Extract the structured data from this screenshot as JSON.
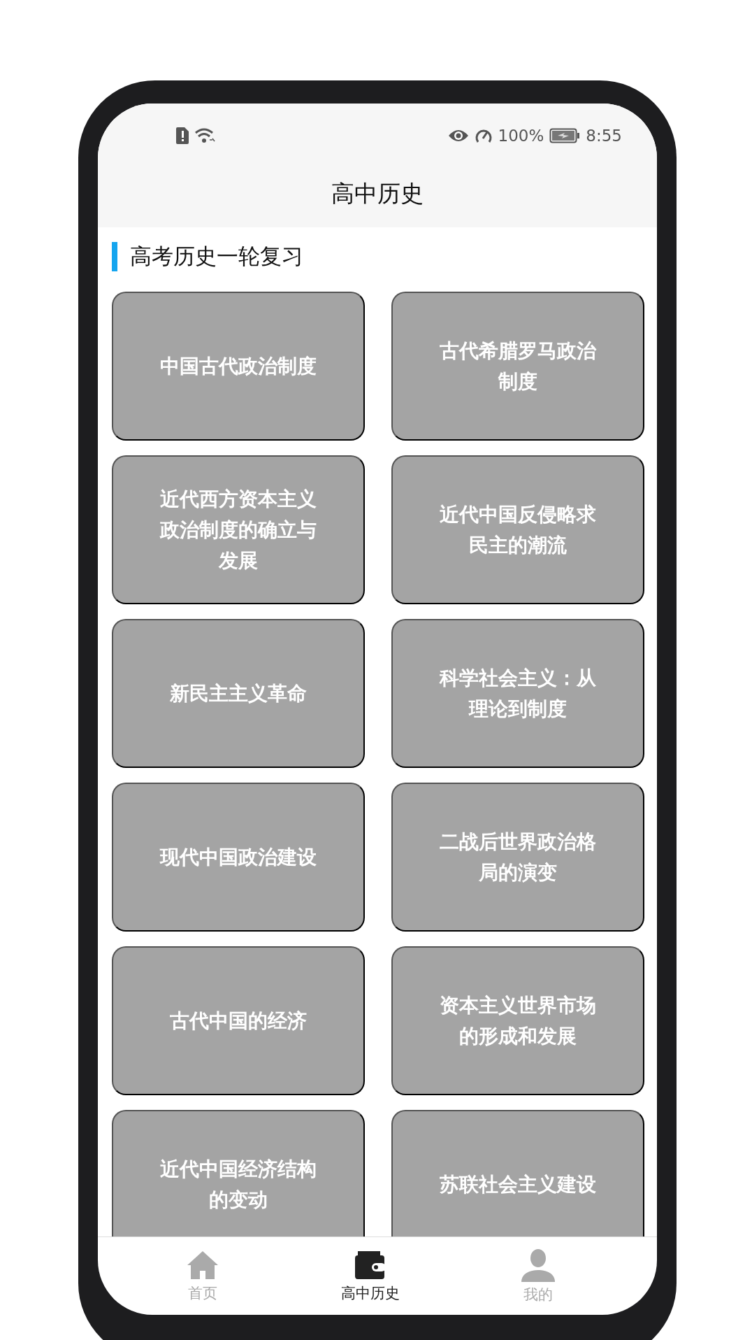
{
  "status_bar": {
    "battery": "100%",
    "time": "8:55"
  },
  "title": "高中历史",
  "section_title": "高考历史一轮复习",
  "topics": [
    "中国古代政治制度",
    "古代希腊罗马政治制度",
    "近代西方资本主义政治制度的确立与发展",
    "近代中国反侵略求民主的潮流",
    "新民主主义革命",
    "科学社会主义：从理论到制度",
    "现代中国政治建设",
    "二战后世界政治格局的演变",
    "古代中国的经济",
    "资本主义世界市场的形成和发展",
    "近代中国经济结构的变动",
    "苏联社会主义建设"
  ],
  "tabs": [
    {
      "label": "首页",
      "selected": false
    },
    {
      "label": "高中历史",
      "selected": true
    },
    {
      "label": "我的",
      "selected": false
    }
  ]
}
